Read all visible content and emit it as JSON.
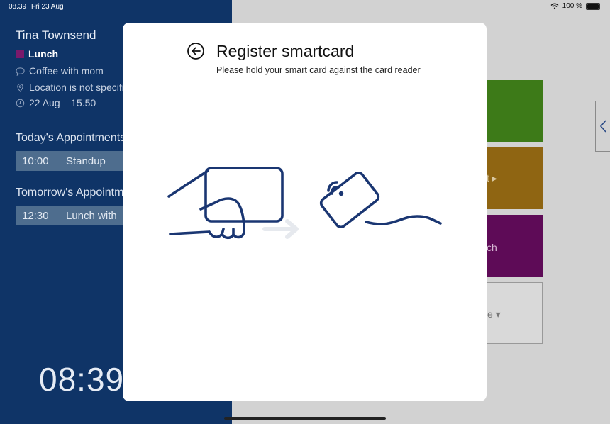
{
  "status_bar": {
    "time": "08.39",
    "date": "Fri 23 Aug",
    "battery": "100 %"
  },
  "room": {
    "name": "Tina Townsend",
    "current_event": {
      "title": "Lunch",
      "color": "#7a1a6c"
    },
    "note": "Coffee with mom",
    "location": "Location is not specific",
    "when": "22 Aug – 15.50"
  },
  "today": {
    "heading": "Today's Appointments",
    "items": [
      {
        "time": "10:00",
        "title": "Standup"
      }
    ]
  },
  "tomorrow": {
    "heading": "Tomorrow's Appointments",
    "items": [
      {
        "time": "12:30",
        "title": "Lunch with"
      }
    ]
  },
  "clock": "08:39",
  "tiles": [
    {
      "color": "#3d7a18",
      "label": ""
    },
    {
      "color": "#8f6512",
      "label": "t ▸"
    },
    {
      "color": "#5e0b57",
      "label": "ch"
    },
    {
      "color": "#d9d9d9",
      "label": "e ▾"
    }
  ],
  "modal": {
    "title": "Register smartcard",
    "subtitle": "Please hold your smart card against the card reader",
    "back_icon": "arrow-left-circle-icon",
    "illustration": "hand-card-to-reader-illustration",
    "illustration_color": "#1a3672"
  }
}
